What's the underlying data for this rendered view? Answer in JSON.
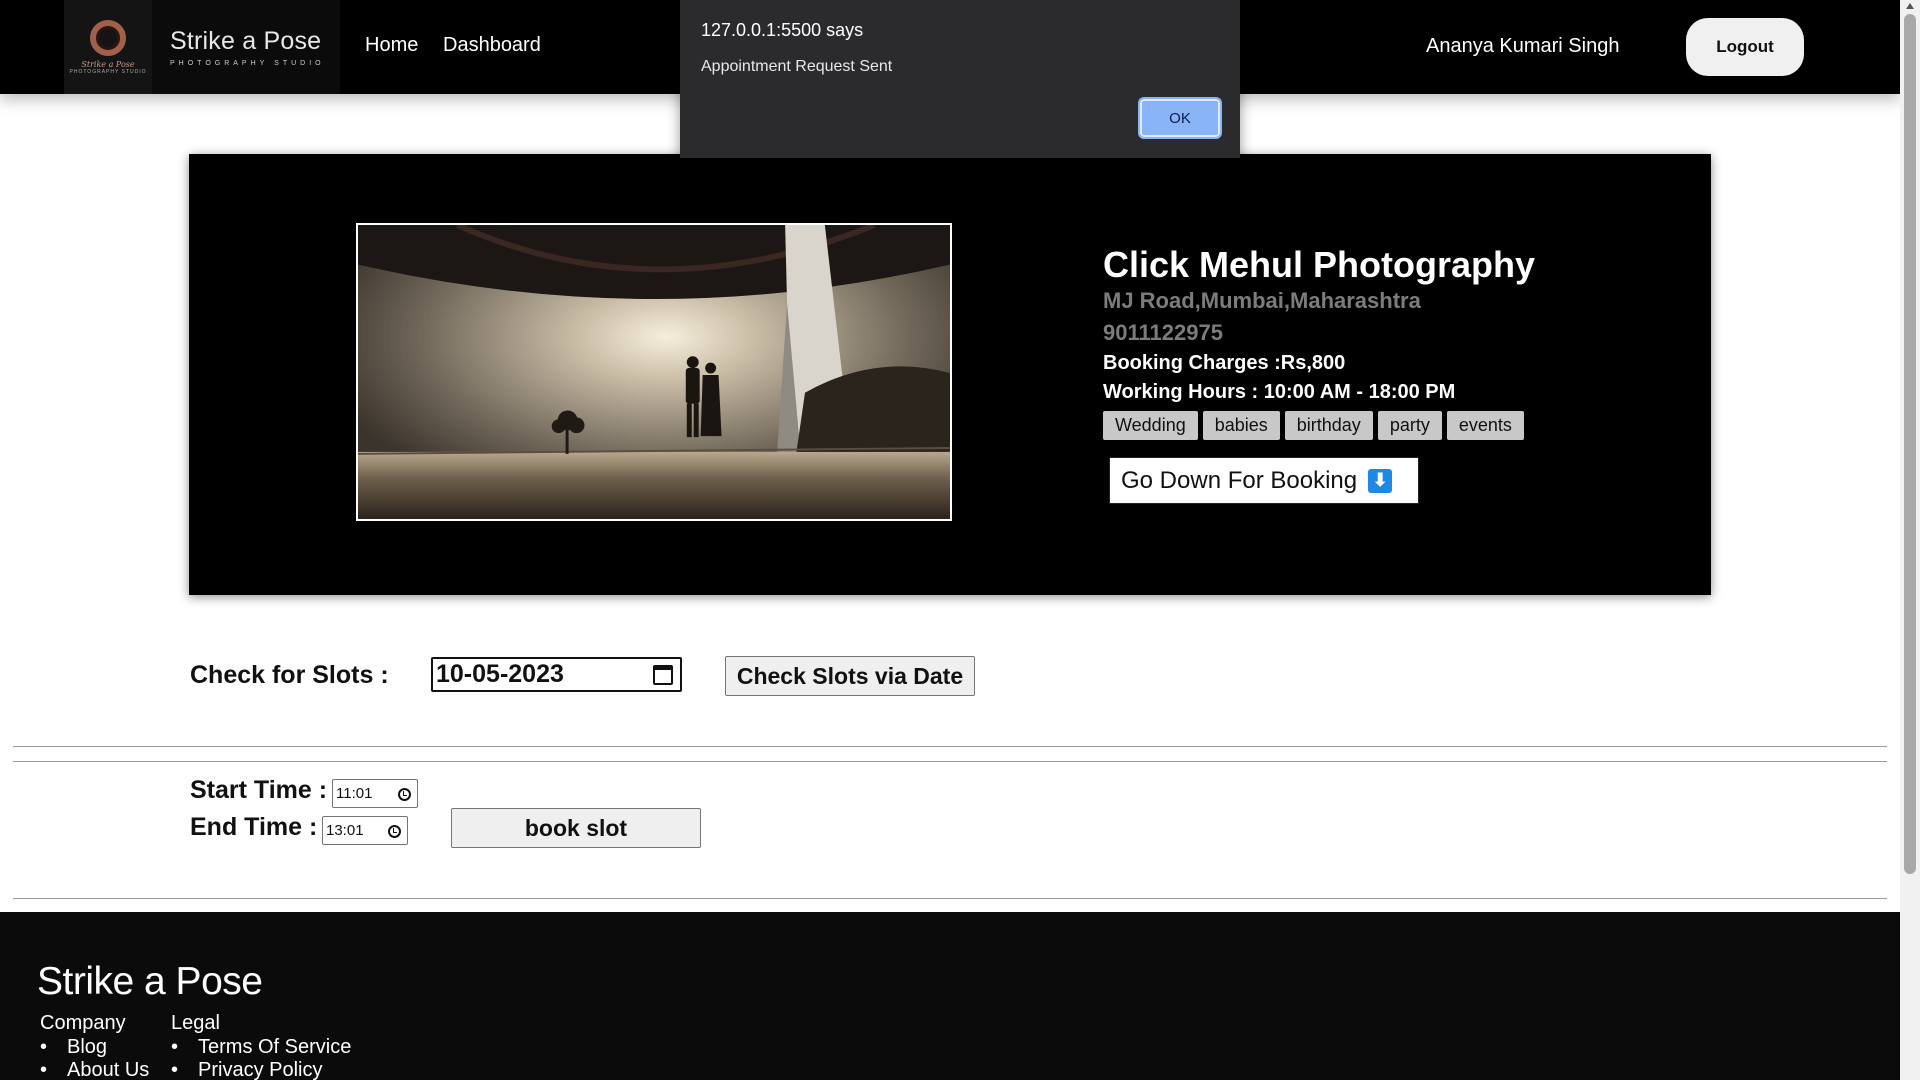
{
  "nav": {
    "brand_title": "Strike a Pose",
    "brand_subtitle": "PHOTOGRAPHY STUDIO",
    "logo_mark_text": "Strike a Pose",
    "logo_mark_sub": "PHOTOGRAPHY STUDIO",
    "home": "Home",
    "dashboard": "Dashboard",
    "user_name": "Ananya Kumari Singh",
    "logout": "Logout"
  },
  "alert": {
    "title": "127.0.0.1:5500 says",
    "message": "Appointment Request Sent",
    "ok": "OK"
  },
  "studio": {
    "name": "Click Mehul Photography",
    "address": "MJ Road,Mumbai,Maharashtra",
    "phone": "9011122975",
    "charges": "Booking Charges :Rs,800",
    "hours": "Working Hours : 10:00 AM - 18:00 PM",
    "tags": [
      "Wedding",
      "babies",
      "birthday",
      "party",
      "events"
    ],
    "go_down_label": "Go Down For Booking",
    "go_down_icon": "⬇"
  },
  "slots": {
    "check_label": "Check for Slots :",
    "date_value": "10-05-2023",
    "check_button": "Check Slots via Date",
    "start_label": "Start Time :",
    "start_value": "11:01",
    "end_label": "End Time :",
    "end_value": "13:01",
    "book_button": "book slot"
  },
  "footer": {
    "brand": "Strike a Pose",
    "company_heading": "Company",
    "company_links": [
      "Blog",
      "About Us"
    ],
    "legal_heading": "Legal",
    "legal_links": [
      "Terms Of Service",
      "Privacy Policy"
    ]
  },
  "colors": {
    "nav_bg": "#000000",
    "card_bg": "#000000",
    "alert_bg": "#2b2b2e",
    "alert_ok": "#8ab4f8",
    "tag_bg": "#c8c8c8",
    "muted_text": "#7c7c7c",
    "footer_bg": "#0b0b0b"
  }
}
